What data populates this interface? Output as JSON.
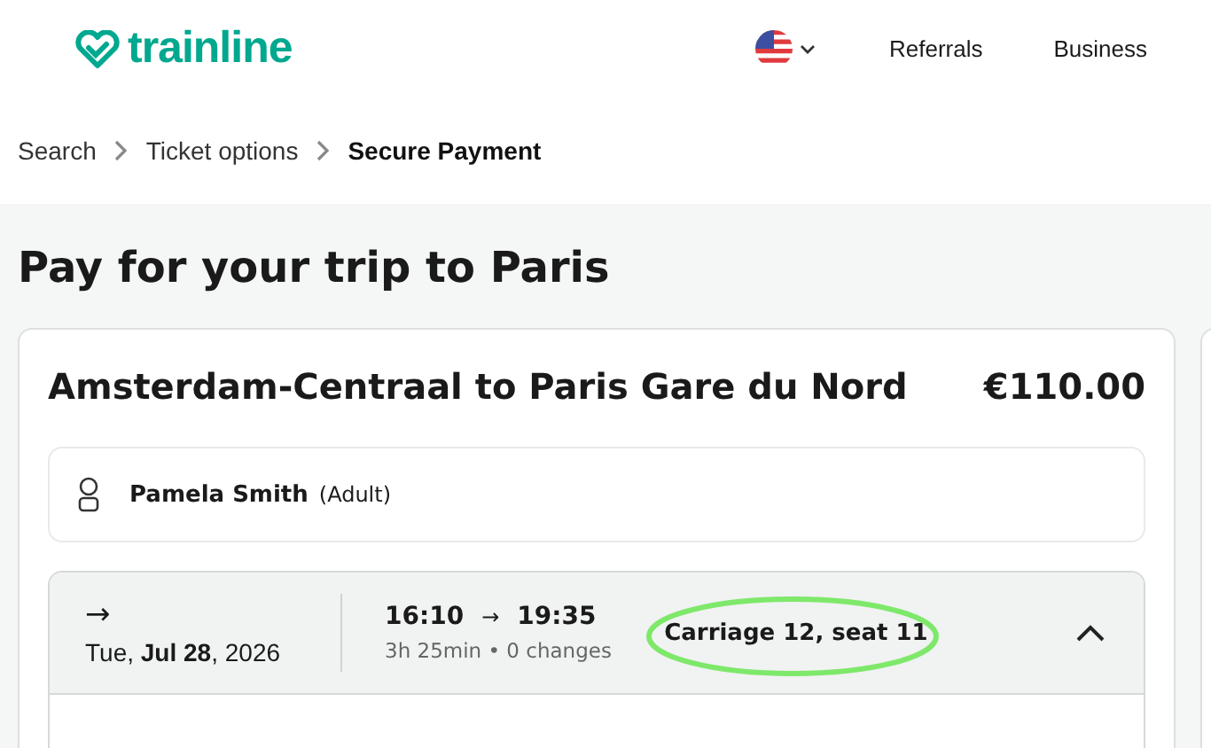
{
  "header": {
    "logo": "trainline",
    "nav": [
      "Referrals",
      "Business"
    ]
  },
  "breadcrumbs": [
    {
      "label": "Search",
      "selected": false
    },
    {
      "label": "Ticket options",
      "selected": false
    },
    {
      "label": "Secure Payment",
      "selected": true
    }
  ],
  "page_title": "Pay for your trip to Paris",
  "trip": {
    "route": "Amsterdam-Centraal to Paris Gare du Nord",
    "price": "€110.00",
    "passenger": {
      "name": "Pamela Smith",
      "type": "(Adult)"
    },
    "journey": {
      "arrow": "→",
      "date": "Tue, **Jul 28**, 2026",
      "depart": "16:10",
      "time_arrow": "→",
      "arrive": "19:35",
      "details": "3h 25min • 0 changes",
      "seat": "Carriage 12, seat 11",
      "seat_highlighted": true,
      "expanded": true
    }
  }
}
